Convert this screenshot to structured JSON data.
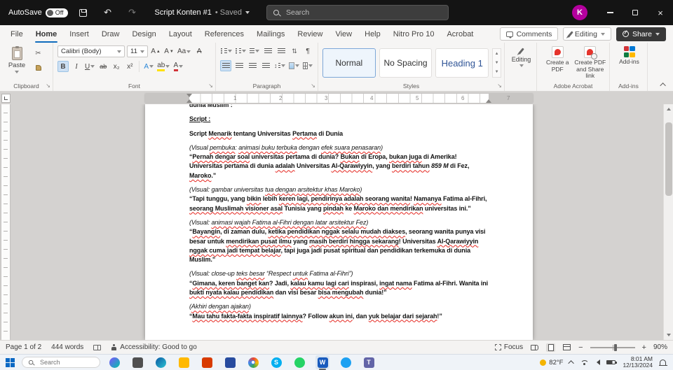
{
  "colors": {
    "accent": "#0f6cbd",
    "avatar": "#b4009e",
    "heading_style_blue": "#2F5496",
    "squiggle_red": "#e5261f",
    "word_blue": "#185abd"
  },
  "titlebar": {
    "autosave_label": "AutoSave",
    "autosave_state": "Off",
    "doc_title": "Script Konten #1",
    "doc_status": "• Saved",
    "search_placeholder": "Search",
    "avatar_initial": "K"
  },
  "menu": {
    "tabs": [
      "File",
      "Home",
      "Insert",
      "Draw",
      "Design",
      "Layout",
      "References",
      "Mailings",
      "Review",
      "View",
      "Help",
      "Nitro Pro 10",
      "Acrobat"
    ],
    "active_tab": "Home",
    "comments_label": "Comments",
    "editing_label": "Editing",
    "share_label": "Share"
  },
  "ribbon": {
    "paste_label": "Paste",
    "font_name": "Calibri (Body)",
    "font_size": "11",
    "buttons": {
      "bold": "B",
      "italic": "I",
      "underline": "U",
      "strikethrough": "ab",
      "subscript": "x₂",
      "superscript": "x²",
      "grow": "A",
      "shrink": "A",
      "case": "Aa",
      "effects": "A",
      "highlight": "ab",
      "fontcolor": "A",
      "pilcrow": "¶"
    },
    "styles": [
      {
        "name": "Normal",
        "selected": true,
        "style": "normal"
      },
      {
        "name": "No Spacing",
        "selected": false,
        "style": "normal"
      },
      {
        "name": "Heading 1",
        "selected": false,
        "style": "heading"
      }
    ],
    "groups": {
      "clipboard": "Clipboard",
      "font": "Font",
      "paragraph": "Paragraph",
      "styles": "Styles",
      "acrobat": "Adobe Acrobat",
      "addins": "Add-ins"
    },
    "editing_label": "Editing",
    "create_pdf_label": "Create a PDF",
    "share_link_label": "Create PDF and Share link",
    "addins_label": "Add-ins"
  },
  "ruler": {
    "numbers": [
      "1",
      "2",
      "3",
      "4",
      "5",
      "6",
      "7"
    ]
  },
  "document": {
    "paragraphs": [
      {
        "clipped": true,
        "runs": [
          {
            "t": "dunia Muslim :",
            "b": true
          }
        ]
      },
      {
        "runs": [
          {
            "t": "Script :",
            "b": true,
            "u": true
          }
        ]
      },
      {
        "runs": [
          {
            "t": "Script ",
            "b": true
          },
          {
            "t": "Menarik",
            "b": true,
            "sq": true
          },
          {
            "t": " tentang Universitas ",
            "b": true
          },
          {
            "t": "Pertama",
            "b": true,
            "sq": true
          },
          {
            "t": " di Dunia",
            "b": true
          }
        ]
      },
      {
        "tight": true,
        "runs": [
          {
            "t": "(Visual ",
            "i": true
          },
          {
            "t": "pembuka",
            "i": true,
            "sq": true
          },
          {
            "t": ": ",
            "i": true
          },
          {
            "t": "animasi buku terbuka",
            "i": true,
            "sq": true
          },
          {
            "t": " dengan ",
            "i": true
          },
          {
            "t": "efek suara penasaran",
            "i": true,
            "sq": true
          },
          {
            "t": ")",
            "i": true
          }
        ]
      },
      {
        "runs": [
          {
            "t": "“",
            "b": true
          },
          {
            "t": "Pernah dengar soal",
            "b": true,
            "sq": true
          },
          {
            "t": " universitas pertama di dunia? ",
            "b": true
          },
          {
            "t": "Bukan",
            "b": true,
            "sq": true
          },
          {
            "t": " di Eropa, ",
            "b": true
          },
          {
            "t": "bukan juga",
            "b": true,
            "sq": true
          },
          {
            "t": " di Amerika! Universitas pertama di dunia ",
            "b": true
          },
          {
            "t": "adalah",
            "b": true,
            "sq": true
          },
          {
            "t": " Universitas ",
            "b": true
          },
          {
            "t": "Al-Qarawiyyin",
            "b": true,
            "sq": true
          },
          {
            "t": ", yang ",
            "b": true
          },
          {
            "t": "berdiri tahun",
            "b": true,
            "sq": true
          },
          {
            "t": " ",
            "b": true
          },
          {
            "t": "859 M",
            "b": true,
            "i": true
          },
          {
            "t": " di Fez, ",
            "b": true
          },
          {
            "t": "Maroko",
            "b": true,
            "sq": true
          },
          {
            "t": ".”",
            "b": true
          }
        ]
      },
      {
        "tight": true,
        "runs": [
          {
            "t": "(Visual: gambar universitas ",
            "i": true
          },
          {
            "t": "tua dengan arsitektur khas Maroko",
            "i": true,
            "sq": true
          },
          {
            "t": ")",
            "i": true
          }
        ]
      },
      {
        "runs": [
          {
            "t": "“Tapi tunggu, yang ",
            "b": true
          },
          {
            "t": "bikin",
            "b": true,
            "sq": true
          },
          {
            "t": " lebih ",
            "b": true
          },
          {
            "t": "keren lagi, pendirinya adalah seorang wanita",
            "b": true,
            "sq": true
          },
          {
            "t": "! ",
            "b": true
          },
          {
            "t": "Namanya",
            "b": true,
            "sq": true
          },
          {
            "t": " Fatima al-Fihri, ",
            "b": true
          },
          {
            "t": "seorang Muslimah visioner asal",
            "b": true,
            "sq": true
          },
          {
            "t": " Tunisia yang ",
            "b": true
          },
          {
            "t": "pindah",
            "b": true,
            "sq": true
          },
          {
            "t": " ke ",
            "b": true
          },
          {
            "t": "Maroko dan mendirikan",
            "b": true,
            "sq": true
          },
          {
            "t": " universitas ini.”",
            "b": true
          }
        ]
      },
      {
        "tight": true,
        "runs": [
          {
            "t": "(Visual: ",
            "i": true
          },
          {
            "t": "animasi wajah Fatima al-Fihri dengan latar arsitektur Fez",
            "i": true,
            "sq": true
          },
          {
            "t": ")",
            "i": true
          }
        ]
      },
      {
        "runs": [
          {
            "t": "“",
            "b": true
          },
          {
            "t": "Bayangin",
            "b": true,
            "sq": true
          },
          {
            "t": ", di zaman dulu, ",
            "b": true
          },
          {
            "t": "ketika pendidikan nggak selalu mudah diakses",
            "b": true,
            "sq": true
          },
          {
            "t": ", seorang wanita punya visi besar untuk ",
            "b": true
          },
          {
            "t": "mendirikan pusat ilmu",
            "b": true,
            "sq": true
          },
          {
            "t": " yang ",
            "b": true
          },
          {
            "t": "masih berdiri hingga sekarang",
            "b": true,
            "sq": true
          },
          {
            "t": "! Universitas ",
            "b": true
          },
          {
            "t": "Al-Qarawiyyin",
            "b": true,
            "sq": true
          },
          {
            "t": " ",
            "b": true
          },
          {
            "t": "nggak cuma jadi tempat belajar",
            "b": true,
            "sq": true
          },
          {
            "t": ", tapi juga jadi pusat spiritual dan pendidikan terkemuka di dunia Muslim.”",
            "b": true
          }
        ]
      },
      {
        "tight": true,
        "runs": [
          {
            "t": "(Visual: close-up ",
            "i": true
          },
          {
            "t": "teks besar",
            "i": true,
            "sq": true
          },
          {
            "t": " “Respect ",
            "i": true
          },
          {
            "t": "untuk",
            "i": true,
            "sq": true
          },
          {
            "t": " Fatima al-Fihri”)",
            "i": true
          }
        ]
      },
      {
        "runs": [
          {
            "t": "“",
            "b": true
          },
          {
            "t": "Gimana, keren banget kan",
            "b": true,
            "sq": true
          },
          {
            "t": "? Jadi, ",
            "b": true
          },
          {
            "t": "kalau kamu lagi cari",
            "b": true,
            "sq": true
          },
          {
            "t": " inspirasi, ",
            "b": true
          },
          {
            "t": "ingat nama",
            "b": true,
            "sq": true
          },
          {
            "t": " Fatima al-Fihri. Wanita ini ",
            "b": true
          },
          {
            "t": "bukti nyata kalau pendidikan",
            "b": true,
            "sq": true
          },
          {
            "t": " dan visi besar ",
            "b": true
          },
          {
            "t": "bisa mengubah",
            "b": true,
            "sq": true
          },
          {
            "t": " dunia!”",
            "b": true
          }
        ]
      },
      {
        "tight": true,
        "runs": [
          {
            "t": "(",
            "i": true
          },
          {
            "t": "Akhiri dengan ajakan",
            "i": true,
            "sq": true
          },
          {
            "t": ")",
            "i": true
          }
        ]
      },
      {
        "runs": [
          {
            "t": "“",
            "b": true
          },
          {
            "t": "Mau tahu fakta-fakta inspiratif lainnya",
            "b": true,
            "sq": true
          },
          {
            "t": "? Follow ",
            "b": true
          },
          {
            "t": "akun ini",
            "b": true,
            "sq": true
          },
          {
            "t": ", dan ",
            "b": true
          },
          {
            "t": "yuk belajar dari sejarah",
            "b": true,
            "sq": true
          },
          {
            "t": "!”",
            "b": true
          }
        ]
      }
    ]
  },
  "statusbar": {
    "page_info": "Page 1 of 2",
    "word_count": "444 words",
    "accessibility": "Accessibility: Good to go",
    "focus_label": "Focus",
    "zoom_level": "90%"
  },
  "taskbar": {
    "search_placeholder": "Search",
    "weather": "82°F",
    "time": "8:01 AM",
    "date": "12/13/2024",
    "apps": [
      {
        "name": "copilot",
        "shape": "circle",
        "grad": [
          "#7F52FF",
          "#00C2A8"
        ]
      },
      {
        "name": "task-view",
        "shape": "square",
        "color": "#505050"
      },
      {
        "name": "edge",
        "shape": "circle",
        "grad": [
          "#0c59a4",
          "#2bc3d2"
        ]
      },
      {
        "name": "file-explorer",
        "shape": "square",
        "color": "#ffb900"
      },
      {
        "name": "office",
        "shape": "square",
        "color": "#d83b01"
      },
      {
        "name": "photos",
        "shape": "square",
        "color": "#274b9f"
      },
      {
        "name": "chrome",
        "shape": "circle",
        "conic": true
      },
      {
        "name": "skype",
        "shape": "circle",
        "color": "#00aff0",
        "letter": "S"
      },
      {
        "name": "whatsapp",
        "shape": "circle",
        "color": "#25d366"
      },
      {
        "name": "word",
        "shape": "square",
        "color": "#185abd",
        "letter": "W",
        "active": true
      },
      {
        "name": "twitter",
        "shape": "circle",
        "color": "#1da1f2"
      },
      {
        "name": "teams",
        "shape": "square",
        "color": "#6264a7",
        "letter": "T"
      }
    ]
  }
}
